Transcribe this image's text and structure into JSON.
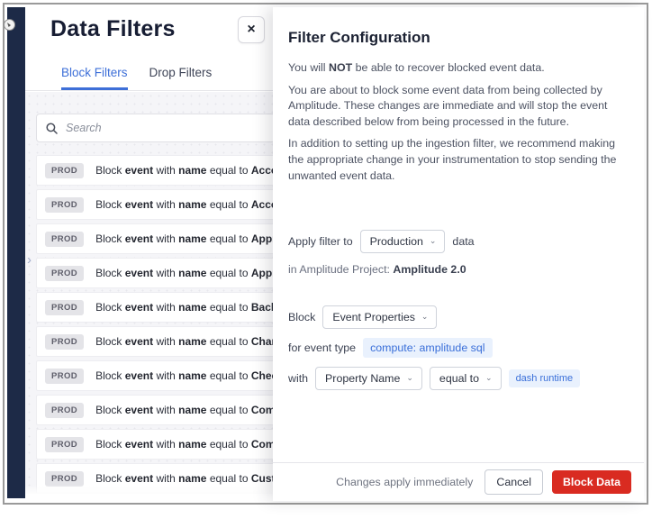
{
  "colors": {
    "navy_rail": "#1d2a47",
    "accent_blue": "#3d6fd8",
    "danger_red": "#d92b21",
    "chip_bg": "#e9f1fd",
    "list_bg": "#f5f5f8"
  },
  "icons": {
    "close": "×",
    "caret": "⌄",
    "collapse_chevron": "›",
    "search": "magnifier"
  },
  "left_panel": {
    "title": "Data Filters",
    "tabs": [
      {
        "label": "Block Filters",
        "active": true
      },
      {
        "label": "Drop Filters",
        "active": false
      }
    ],
    "search_placeholder": "Search",
    "row_words": {
      "block": "Block",
      "event": "event",
      "with": "with",
      "name": "name",
      "equal": "equal to"
    },
    "filters": [
      {
        "env": "PROD",
        "name": "Acco"
      },
      {
        "env": "PROD",
        "name": "Acco"
      },
      {
        "env": "PROD",
        "name": "Appr"
      },
      {
        "env": "PROD",
        "name": "Appr"
      },
      {
        "env": "PROD",
        "name": "Back"
      },
      {
        "env": "PROD",
        "name": "Chan"
      },
      {
        "env": "PROD",
        "name": "Chec"
      },
      {
        "env": "PROD",
        "name": "Comp"
      },
      {
        "env": "PROD",
        "name": "Comp"
      },
      {
        "env": "PROD",
        "name": "Cust"
      }
    ]
  },
  "right_panel": {
    "title": "Filter Configuration",
    "warning": {
      "pre": "You will ",
      "bold": "NOT",
      "post": " be able to recover blocked event data."
    },
    "para2": "You are about to block some event data from being collected by Amplitude. These changes are immediate and will stop the event data described below from being processed in the future.",
    "para3": "In addition to setting up the ingestion filter, we recommend making the appropriate change in your instrumentation to stop sending the unwanted event data.",
    "apply": {
      "prefix": "Apply filter to",
      "environment_value": "Production",
      "suffix": "data"
    },
    "project": {
      "prefix": "in Amplitude Project: ",
      "name": "Amplitude 2.0"
    },
    "block": {
      "label": "Block",
      "type_value": "Event Properties"
    },
    "event_type": {
      "label": "for event type",
      "chip": "compute: amplitude sql"
    },
    "with_row": {
      "label": "with",
      "property_value": "Property Name",
      "operator_value": "equal to",
      "value_chip": "dash runtime"
    },
    "footer": {
      "note": "Changes apply immediately",
      "cancel_label": "Cancel",
      "submit_label": "Block Data"
    }
  }
}
